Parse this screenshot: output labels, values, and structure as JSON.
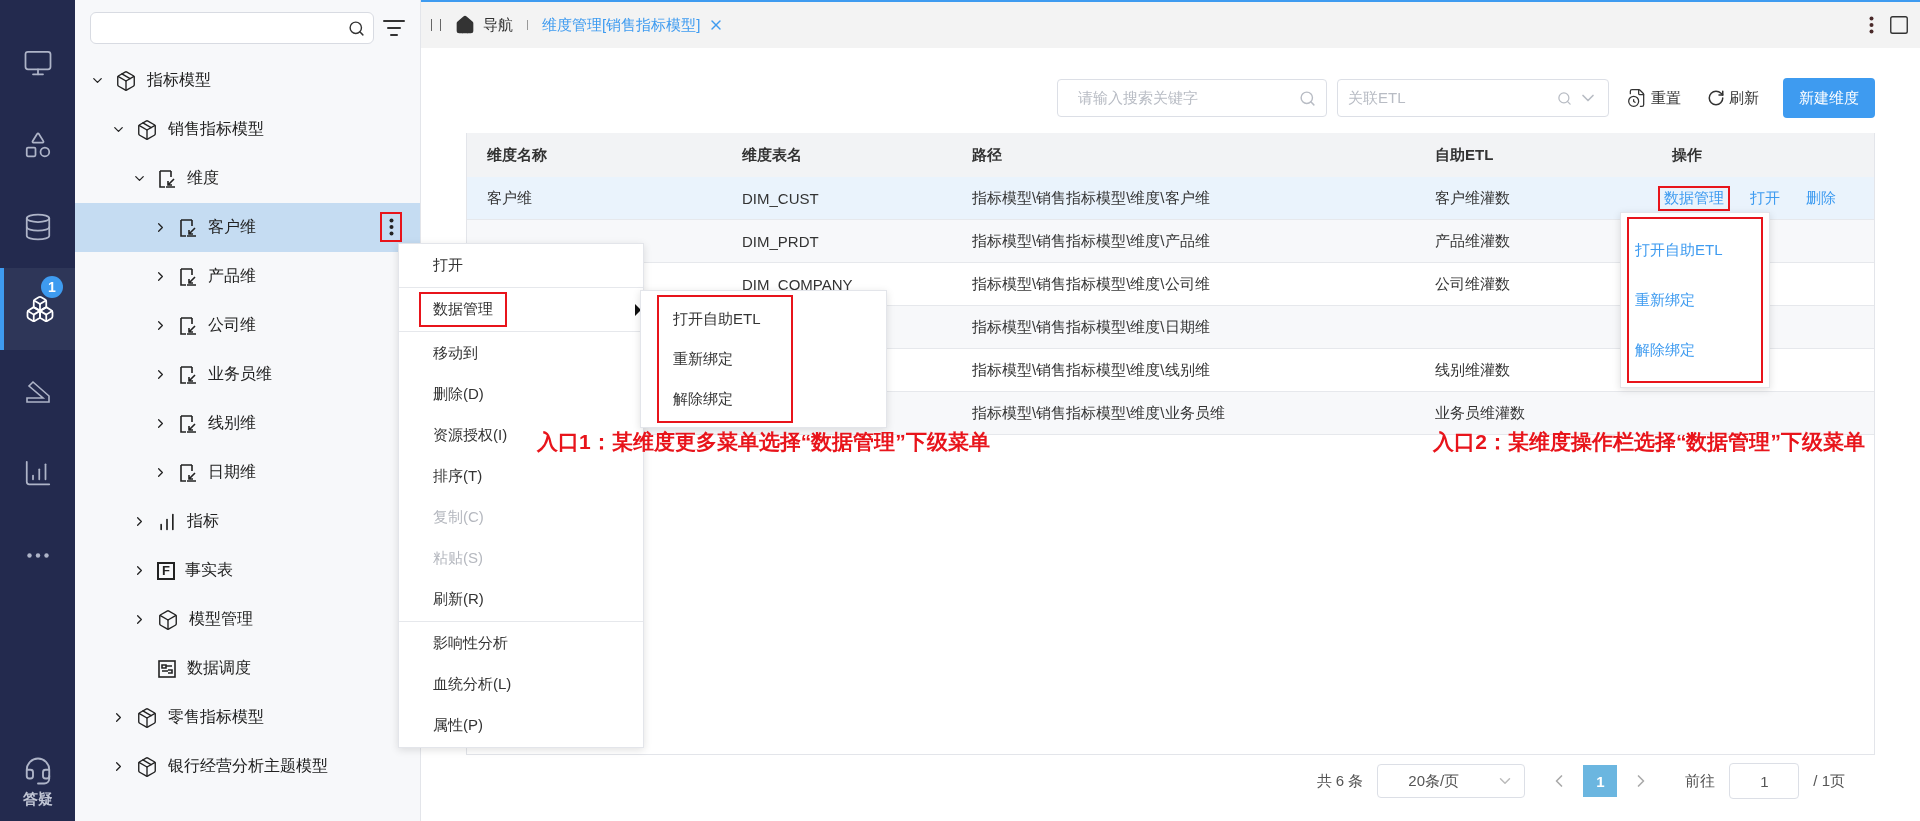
{
  "rail": {
    "items": [
      {
        "kind": "monitor",
        "selected": false
      },
      {
        "kind": "apps",
        "selected": false
      },
      {
        "kind": "database",
        "selected": false
      },
      {
        "kind": "cubes",
        "selected": true,
        "badge": "1"
      },
      {
        "kind": "ramp",
        "selected": false
      },
      {
        "kind": "chart",
        "selected": false
      },
      {
        "kind": "more",
        "selected": false
      }
    ],
    "help": {
      "label": "答疑"
    }
  },
  "tree": {
    "items": [
      {
        "kind": "model",
        "label": "指标模型",
        "expanded": true,
        "selected": false,
        "children": [
          {
            "kind": "model",
            "label": "销售指标模型",
            "expanded": true,
            "selected": false,
            "children": [
              {
                "kind": "dimensions",
                "label": "维度",
                "expanded": true,
                "selected": false,
                "children": [
                  {
                    "kind": "dimension",
                    "label": "客户维",
                    "expanded": false,
                    "selected": true,
                    "more_button": {
                      "highlighted": true
                    }
                  },
                  {
                    "kind": "dimension",
                    "label": "产品维",
                    "expanded": false,
                    "selected": false
                  },
                  {
                    "kind": "dimension",
                    "label": "公司维",
                    "expanded": false,
                    "selected": false
                  },
                  {
                    "kind": "dimension",
                    "label": "业务员维",
                    "expanded": false,
                    "selected": false
                  },
                  {
                    "kind": "dimension",
                    "label": "线别维",
                    "expanded": false,
                    "selected": false
                  },
                  {
                    "kind": "dimension",
                    "label": "日期维",
                    "expanded": false,
                    "selected": false
                  }
                ]
              },
              {
                "kind": "metrics",
                "label": "指标",
                "expanded": false,
                "selected": false
              },
              {
                "kind": "fact",
                "label": "事实表",
                "icon_letter": "F",
                "expanded": false,
                "selected": false
              },
              {
                "kind": "manage",
                "label": "模型管理",
                "expanded": false,
                "selected": false
              },
              {
                "kind": "schedule",
                "label": "数据调度",
                "selected": false
              }
            ]
          },
          {
            "kind": "model",
            "label": "零售指标模型",
            "expanded": false,
            "selected": false
          },
          {
            "kind": "model",
            "label": "银行经营分析主题模型",
            "expanded": false,
            "selected": false
          }
        ]
      }
    ]
  },
  "tab_bar": {
    "tabs": [
      {
        "kind": "home",
        "label": "导航",
        "selected": false
      },
      {
        "kind": "page",
        "label": "维度管理[销售指标模型]",
        "selected": true,
        "closable": true
      }
    ]
  },
  "toolbar": {
    "search": {
      "placeholder": "请输入搜索关键字"
    },
    "etl_select": {
      "placeholder": "关联ETL"
    },
    "buttons": [
      {
        "kind": "reset",
        "label": "重置"
      },
      {
        "kind": "refresh",
        "label": "刷新"
      },
      {
        "kind": "primary",
        "label": "新建维度"
      }
    ]
  },
  "table": {
    "columns": [
      "维度名称",
      "维度表名",
      "路径",
      "自助ETL",
      "操作"
    ],
    "rows": [
      {
        "selected": true,
        "name": "客户维",
        "table": "DIM_CUST",
        "path": "指标模型\\销售指标模型\\维度\\客户维",
        "etl": "客户维灌数",
        "actions": [
          {
            "label": "数据管理",
            "highlighted": true
          },
          {
            "label": "打开",
            "highlighted": false
          },
          {
            "label": "删除",
            "highlighted": false
          }
        ]
      },
      {
        "selected": false,
        "table": "DIM_PRDT",
        "path": "指标模型\\销售指标模型\\维度\\产品维",
        "etl": "产品维灌数"
      },
      {
        "selected": false,
        "table": "DIM_COMPANY",
        "path": "指标模型\\销售指标模型\\维度\\公司维",
        "etl": "公司维灌数"
      },
      {
        "selected": false,
        "path": "指标模型\\销售指标模型\\维度\\日期维"
      },
      {
        "selected": false,
        "path": "指标模型\\销售指标模型\\维度\\线别维",
        "etl": "线别维灌数"
      },
      {
        "selected": false,
        "path": "指标模型\\销售指标模型\\维度\\业务员维",
        "etl": "业务员维灌数"
      }
    ]
  },
  "pagination": {
    "total": "共 6 条",
    "page_size": "20条/页",
    "pages": [
      {
        "label": "1",
        "selected": true
      }
    ],
    "goto_label": "前往",
    "goto_value": "1",
    "page_count": "/ 1页"
  },
  "context_menu": {
    "groups": [
      [
        {
          "label": "打开",
          "disabled": false,
          "submenu": false,
          "highlighted": false
        }
      ],
      [
        {
          "label": "数据管理",
          "disabled": false,
          "submenu": true,
          "highlighted": true
        }
      ],
      [
        {
          "label": "移动到",
          "disabled": false,
          "submenu": false,
          "highlighted": false
        },
        {
          "label": "删除(D)",
          "disabled": false,
          "submenu": false,
          "highlighted": false
        },
        {
          "label": "资源授权(I)",
          "disabled": false,
          "submenu": false,
          "highlighted": false
        },
        {
          "label": "排序(T)",
          "disabled": false,
          "submenu": false,
          "highlighted": false
        },
        {
          "label": "复制(C)",
          "disabled": true,
          "submenu": false,
          "highlighted": false
        },
        {
          "label": "粘贴(S)",
          "disabled": true,
          "submenu": false,
          "highlighted": false
        },
        {
          "label": "刷新(R)",
          "disabled": false,
          "submenu": false,
          "highlighted": false
        }
      ],
      [
        {
          "label": "影响性分析",
          "disabled": false,
          "submenu": false,
          "highlighted": false
        },
        {
          "label": "血统分析(L)",
          "disabled": false,
          "submenu": false,
          "highlighted": false
        },
        {
          "label": "属性(P)",
          "disabled": false,
          "submenu": false,
          "highlighted": false
        }
      ]
    ]
  },
  "submenu": {
    "highlighted": true,
    "items": [
      "打开自助ETL",
      "重新绑定",
      "解除绑定"
    ]
  },
  "row_menu": {
    "highlighted": true,
    "items": [
      "打开自助ETL",
      "重新绑定",
      "解除绑定"
    ]
  },
  "annotations": [
    {
      "kind": "left",
      "text": "入口1：某维度更多菜单选择“数据管理”下级菜单"
    },
    {
      "kind": "right",
      "text": "入口2：某维度操作栏选择“数据管理”下级菜单"
    }
  ]
}
